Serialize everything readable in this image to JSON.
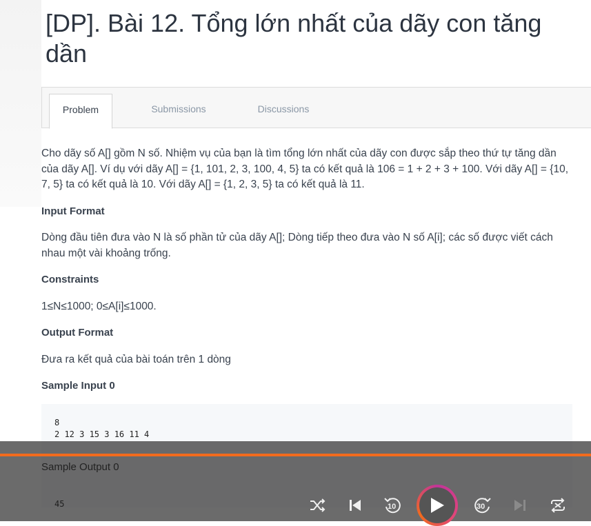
{
  "title": "[DP]. Bài 12. Tổng lớn nhất của dãy con tăng dần",
  "tabs": [
    {
      "label": "Problem",
      "active": true
    },
    {
      "label": "Submissions",
      "active": false
    },
    {
      "label": "Discussions",
      "active": false
    }
  ],
  "statement": "Cho dãy số A[] gồm N số. Nhiệm vụ của bạn là tìm tổng lớn nhất của dãy con được sắp theo thứ tự tăng dần của dãy A[]. Ví dụ với dãy A[] = {1, 101, 2, 3, 100, 4, 5} ta có kết quả là 106 = 1 + 2 + 3 + 100. Với dãy A[] = {10, 7, 5} ta có kết quả là 10. Với dãy A[] = {1, 2, 3, 5} ta có kết quả là 11.",
  "input_format": {
    "heading": "Input Format",
    "text": "Dòng đầu tiên đưa vào N là số phần tử của dãy A[]; Dòng tiếp theo đưa vào N số A[i]; các số được viết cách nhau một vài khoảng trống."
  },
  "constraints": {
    "heading": "Constraints",
    "text": "1≤N≤1000; 0≤A[i]≤1000."
  },
  "output_format": {
    "heading": "Output Format",
    "text": "Đưa ra kết quả của bài toán trên 1 dòng"
  },
  "sample_input": {
    "heading": "Sample Input 0",
    "lines": [
      "8",
      "2 12 3 15 3 16 11 4"
    ]
  },
  "sample_output": {
    "heading": "Sample Output 0",
    "lines": [
      "45"
    ]
  },
  "player": {
    "rewind_label": "10",
    "forward_label": "30",
    "progress_color": "#f26b1d"
  }
}
